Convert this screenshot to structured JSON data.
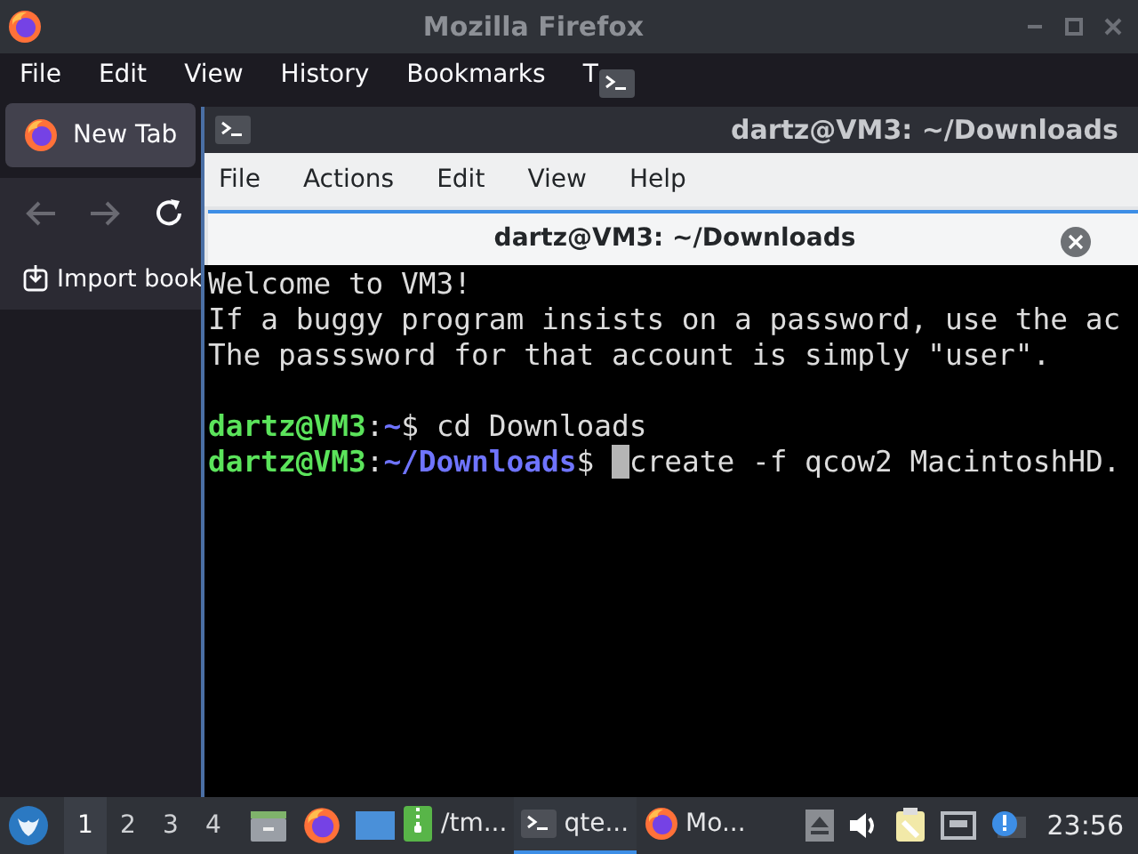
{
  "firefox": {
    "title": "Mozilla Firefox",
    "menu": [
      "File",
      "Edit",
      "View",
      "History",
      "Bookmarks",
      "T"
    ],
    "tabs": [
      {
        "label": "New Tab",
        "selected": true
      }
    ],
    "bookmark": "Import book"
  },
  "terminal": {
    "title": "dartz@VM3: ~/Downloads",
    "menu": [
      "File",
      "Actions",
      "Edit",
      "View",
      "Help"
    ],
    "tabs": [
      {
        "label": "dartz@VM3: ~/Downloads",
        "selected": true
      }
    ],
    "lines": [
      {
        "kind": "text",
        "text": "Welcome to VM3!"
      },
      {
        "kind": "text",
        "text": "If a buggy program insists on a password, use the ac"
      },
      {
        "kind": "text",
        "text": "The passsword for that account is simply \"user\"."
      },
      {
        "kind": "blank"
      },
      {
        "kind": "prompt",
        "user": "dartz@VM3",
        "separator": ":",
        "path": "~",
        "sign": "$",
        "command": "cd Downloads",
        "cursor": false
      },
      {
        "kind": "prompt",
        "user": "dartz@VM3",
        "separator": ":",
        "path": "~/Downloads",
        "sign": "$",
        "command": "create -f qcow2 MacintoshHD.",
        "cursor": true
      }
    ]
  },
  "taskbar": {
    "workspaces": [
      {
        "label": "1",
        "selected": true
      },
      {
        "label": "2",
        "selected": false
      },
      {
        "label": "3",
        "selected": false
      },
      {
        "label": "4",
        "selected": false
      }
    ],
    "tasks": [
      {
        "kind": "archive",
        "label": "/tm...",
        "selected": false
      },
      {
        "kind": "terminal",
        "label": "qte...",
        "selected": true
      },
      {
        "kind": "firefox",
        "label": "Mo...",
        "selected": false
      }
    ],
    "clock": "23:56"
  }
}
